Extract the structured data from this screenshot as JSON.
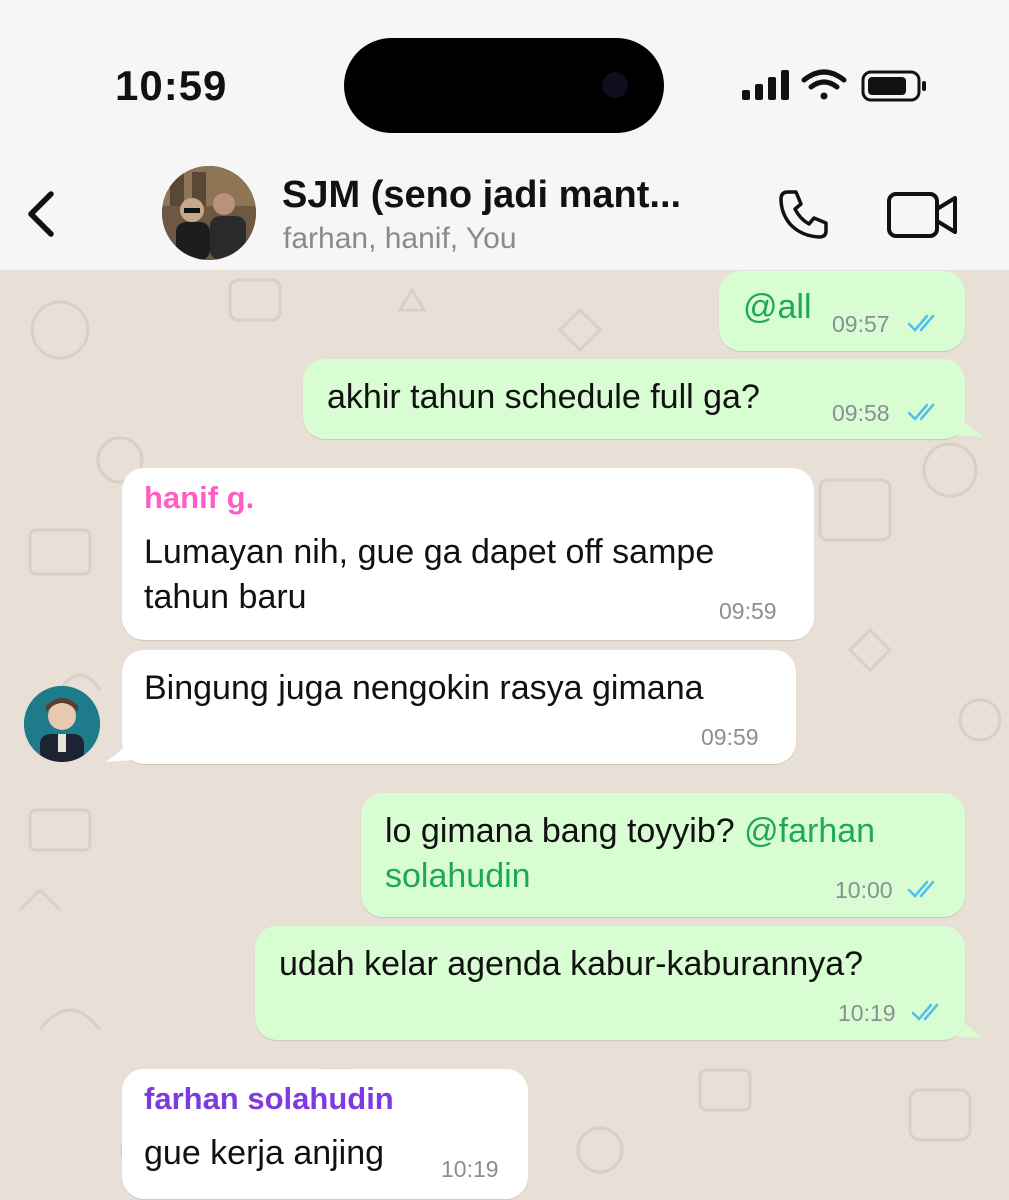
{
  "status": {
    "time": "10:59"
  },
  "header": {
    "title": "SJM (seno jadi mant...",
    "subtitle": "farhan, hanif, You"
  },
  "messages": [
    {
      "text": "@all",
      "time": "09:57"
    },
    {
      "text": "akhir tahun schedule full ga?",
      "time": "09:58"
    },
    {
      "sender": "hanif g.",
      "sender_color": "#ff5ec4",
      "line1": "Lumayan nih, gue ga dapet off sampe",
      "line2": "tahun baru",
      "time": "09:59"
    },
    {
      "text": "Bingung juga nengokin rasya gimana",
      "time": "09:59"
    },
    {
      "line1_plain": "lo gimana bang toyyib? ",
      "line1_mention": "@farhan",
      "line2_mention": "solahudin",
      "time": "10:00"
    },
    {
      "text": "udah kelar agenda kabur-kaburannya?",
      "time": "10:19"
    },
    {
      "sender": "farhan solahudin",
      "sender_color": "#7c3ae0",
      "text": "gue kerja anjing",
      "time": "10:19"
    }
  ],
  "colors": {
    "outgoing_bubble": "#d9fdd3",
    "incoming_bubble": "#ffffff",
    "mention": "#1fa855",
    "read_ticks": "#53bdeb",
    "wallpaper": "#e8e0d6"
  },
  "icons": [
    "back-chevron-icon",
    "phone-icon",
    "video-camera-icon",
    "signal-icon",
    "wifi-icon",
    "battery-icon",
    "double-check-icon"
  ]
}
